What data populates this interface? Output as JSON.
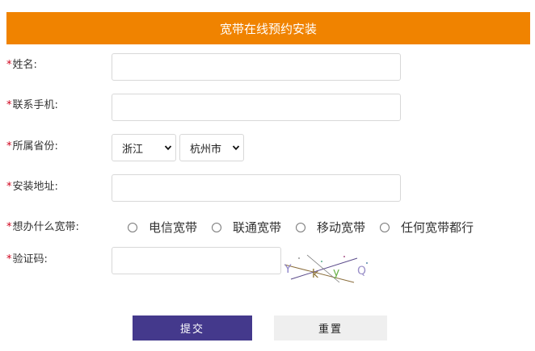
{
  "header": {
    "title": "宽带在线预约安装"
  },
  "form": {
    "required_mark": "*",
    "name_label": "姓名:",
    "phone_label": "联系手机:",
    "region_label": "所属省份:",
    "province_value": "浙江",
    "city_value": "杭州市",
    "address_label": "安装地址:",
    "broadband_label": "想办什么宽带:",
    "broadband_options": [
      "电信宽带",
      "联通宽带",
      "移动宽带",
      "任何宽带都行"
    ],
    "captcha_label": "验证码:",
    "captcha_text": "YkyQ"
  },
  "buttons": {
    "submit": "提交",
    "reset": "重置"
  },
  "colors": {
    "header_bg": "#f08300",
    "submit_bg": "#44398c",
    "required": "#d0021b"
  }
}
